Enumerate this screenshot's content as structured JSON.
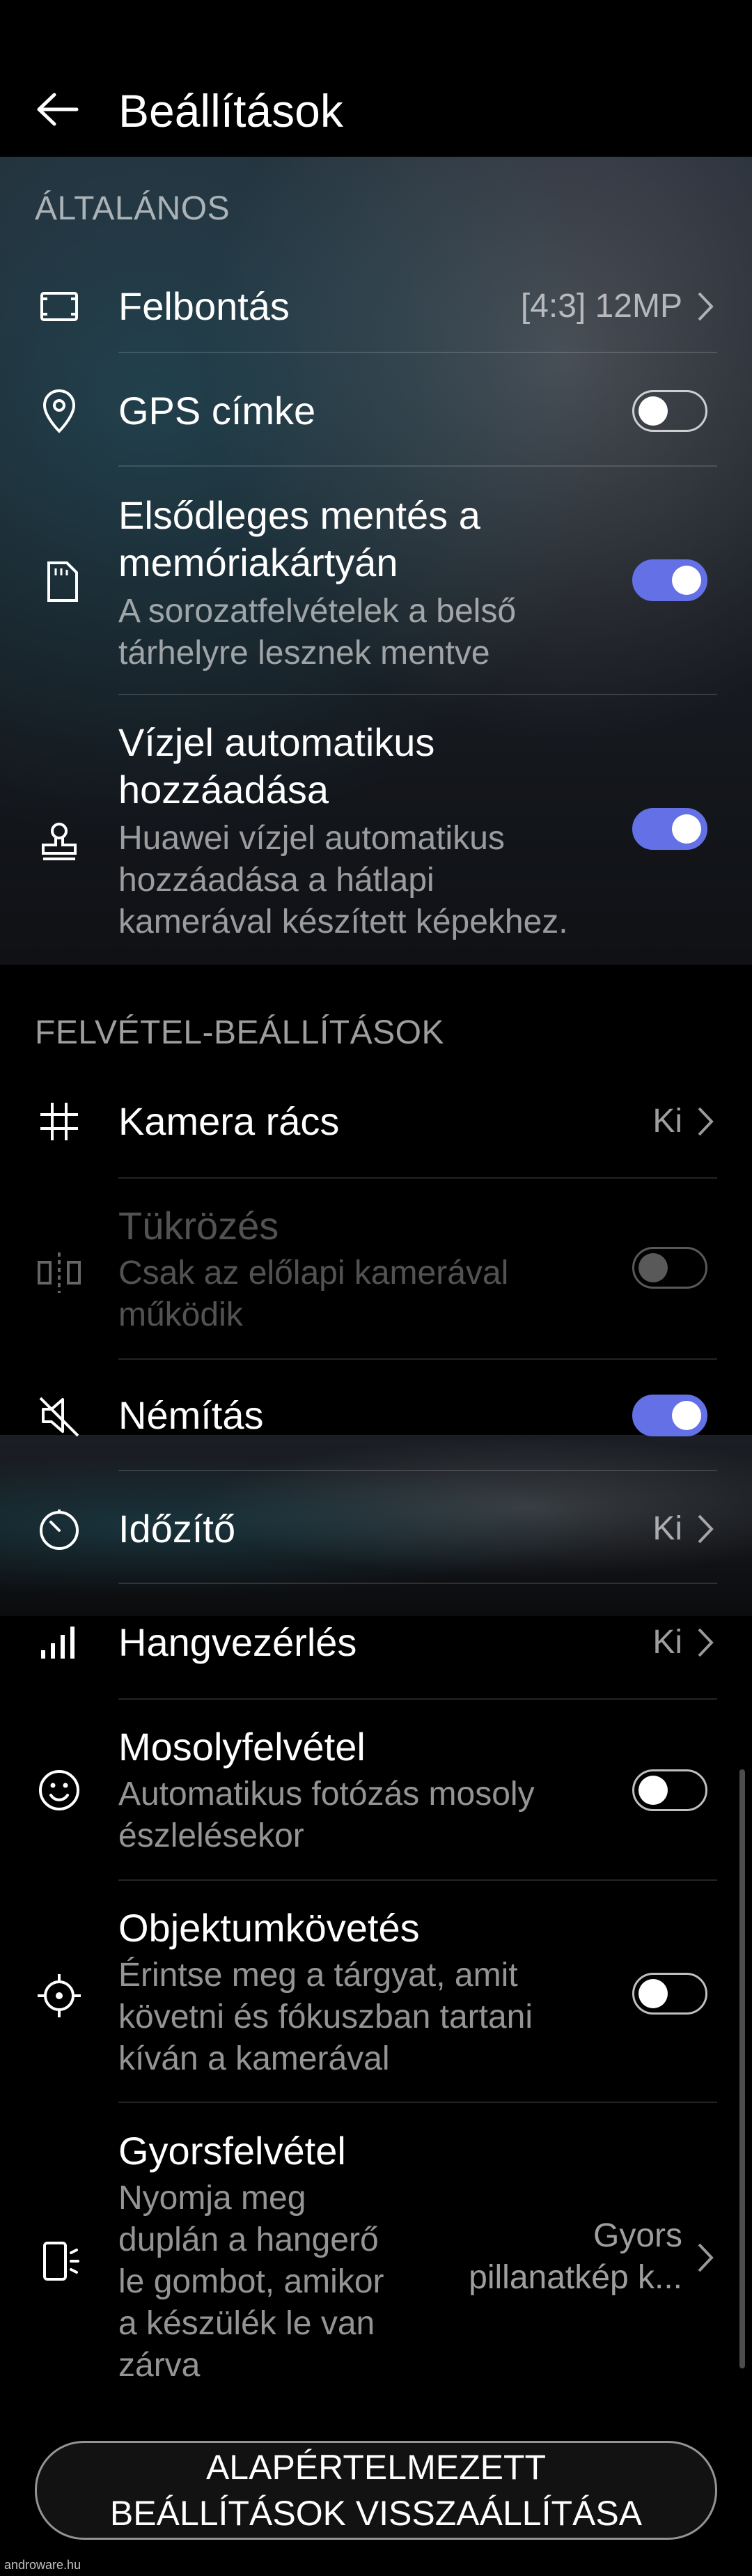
{
  "header": {
    "title": "Beállítások"
  },
  "sections": {
    "general": "ÁLTALÁNOS",
    "capture": "FELVÉTEL-BEÁLLÍTÁSOK"
  },
  "rows": {
    "resolution": {
      "title": "Felbontás",
      "value": "[4:3] 12MP"
    },
    "gps": {
      "title": "GPS címke",
      "toggle": false
    },
    "sdcard": {
      "title_line1": "Elsődleges mentés a",
      "title_line2": "memóriakártyán",
      "sub_line1": "A sorozatfelvételek a belső",
      "sub_line2": "tárhelyre lesznek mentve",
      "toggle": true
    },
    "watermark": {
      "title_line1": "Vízjel automatikus",
      "title_line2": "hozzáadása",
      "sub_line1": "Huawei vízjel automatikus",
      "sub_line2": "hozzáadása a hátlapi",
      "sub_line3": "kamerával készített képekhez.",
      "toggle": true
    },
    "grid": {
      "title": "Kamera rács",
      "value": "Ki"
    },
    "mirror": {
      "title": "Tükrözés",
      "sub_line1": "Csak az előlapi kamerával",
      "sub_line2": "működik",
      "toggle": false
    },
    "mute": {
      "title": "Némítás",
      "toggle": true
    },
    "timer": {
      "title": "Időzítő",
      "value": "Ki"
    },
    "voice": {
      "title": "Hangvezérlés",
      "value": "Ki"
    },
    "smile": {
      "title": "Mosolyfelvétel",
      "sub_line1": "Automatikus fotózás mosoly",
      "sub_line2": "észlelésekor",
      "toggle": false
    },
    "tracking": {
      "title": "Objektumkövetés",
      "sub_line1": "Érintse meg a tárgyat, amit",
      "sub_line2": "követni és fókuszban tartani",
      "sub_line3": "kíván a kamerával",
      "toggle": false
    },
    "ultrasnap": {
      "title": "Gyorsfelvétel",
      "sub_line1": "Nyomja meg",
      "sub_line2": "duplán a hangerő",
      "sub_line3": "le gombot, amikor",
      "sub_line4": "a készülék le van",
      "sub_line5": "zárva",
      "value_line1": "Gyors",
      "value_line2": "pillanatkép k..."
    }
  },
  "reset_button": {
    "line1": "ALAPÉRTELMEZETT",
    "line2": "BEÁLLÍTÁSOK VISSZAÁLLÍTÁSA"
  },
  "watermark_text": "androware.hu",
  "colors": {
    "accent": "#6470e6",
    "background": "#000000"
  }
}
